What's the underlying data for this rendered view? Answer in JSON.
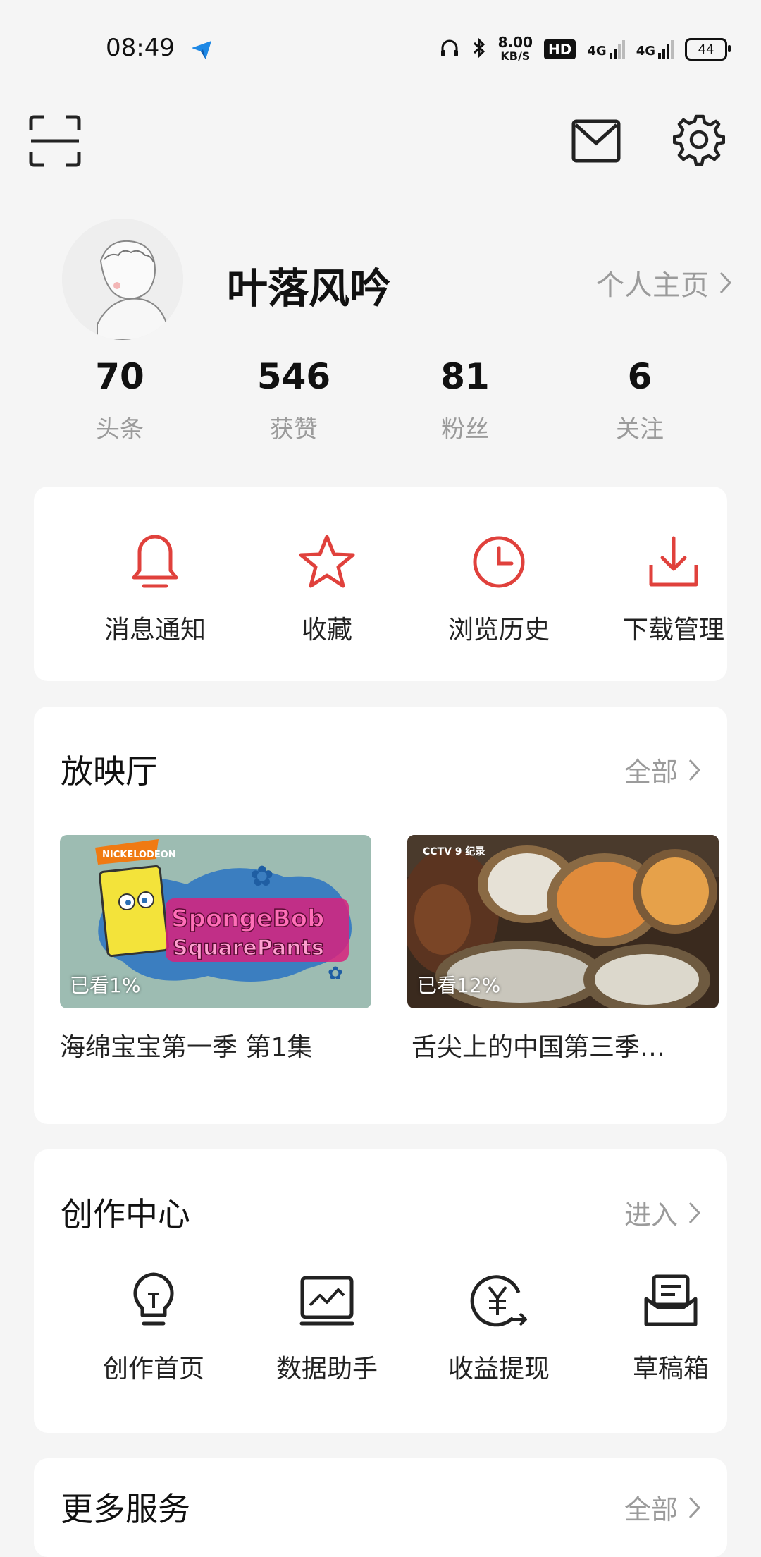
{
  "status_bar": {
    "time": "08:49",
    "network_speed": "8.00",
    "network_unit": "KB/S",
    "hd_label": "HD",
    "signal1": "4G",
    "signal2": "4G",
    "battery": "44"
  },
  "header": {
    "scan_icon": "scan-icon",
    "mail_icon": "mail-icon",
    "settings_icon": "gear-icon"
  },
  "profile": {
    "username": "叶落风吟",
    "homepage_link": "个人主页"
  },
  "stats": [
    {
      "value": "70",
      "label": "头条"
    },
    {
      "value": "546",
      "label": "获赞"
    },
    {
      "value": "81",
      "label": "粉丝"
    },
    {
      "value": "6",
      "label": "关注"
    }
  ],
  "quick_actions": [
    {
      "label": "消息通知",
      "icon": "bell-icon"
    },
    {
      "label": "收藏",
      "icon": "star-icon"
    },
    {
      "label": "浏览历史",
      "icon": "clock-icon"
    },
    {
      "label": "下载管理",
      "icon": "download-icon"
    }
  ],
  "theater": {
    "title": "放映厅",
    "more": "全部",
    "items": [
      {
        "title": "海绵宝宝第一季 第1集",
        "progress": "已看1%",
        "thumb_text": "SpongeBob SquarePants",
        "badge": "NICKELODEON"
      },
      {
        "title": "舌尖上的中国第三季…",
        "progress": "已看12%",
        "badge": "CCTV 9 纪录"
      }
    ]
  },
  "creation": {
    "title": "创作中心",
    "more": "进入",
    "items": [
      {
        "label": "创作首页",
        "icon": "lightbulb-icon"
      },
      {
        "label": "数据助手",
        "icon": "chart-icon"
      },
      {
        "label": "收益提现",
        "icon": "yuan-icon"
      },
      {
        "label": "草稿箱",
        "icon": "drafts-icon"
      }
    ]
  },
  "more_services": {
    "title": "更多服务",
    "more": "全部"
  },
  "colors": {
    "accent_red": "#e0413c",
    "background": "#f5f5f5",
    "muted_text": "#9b9b9b"
  }
}
